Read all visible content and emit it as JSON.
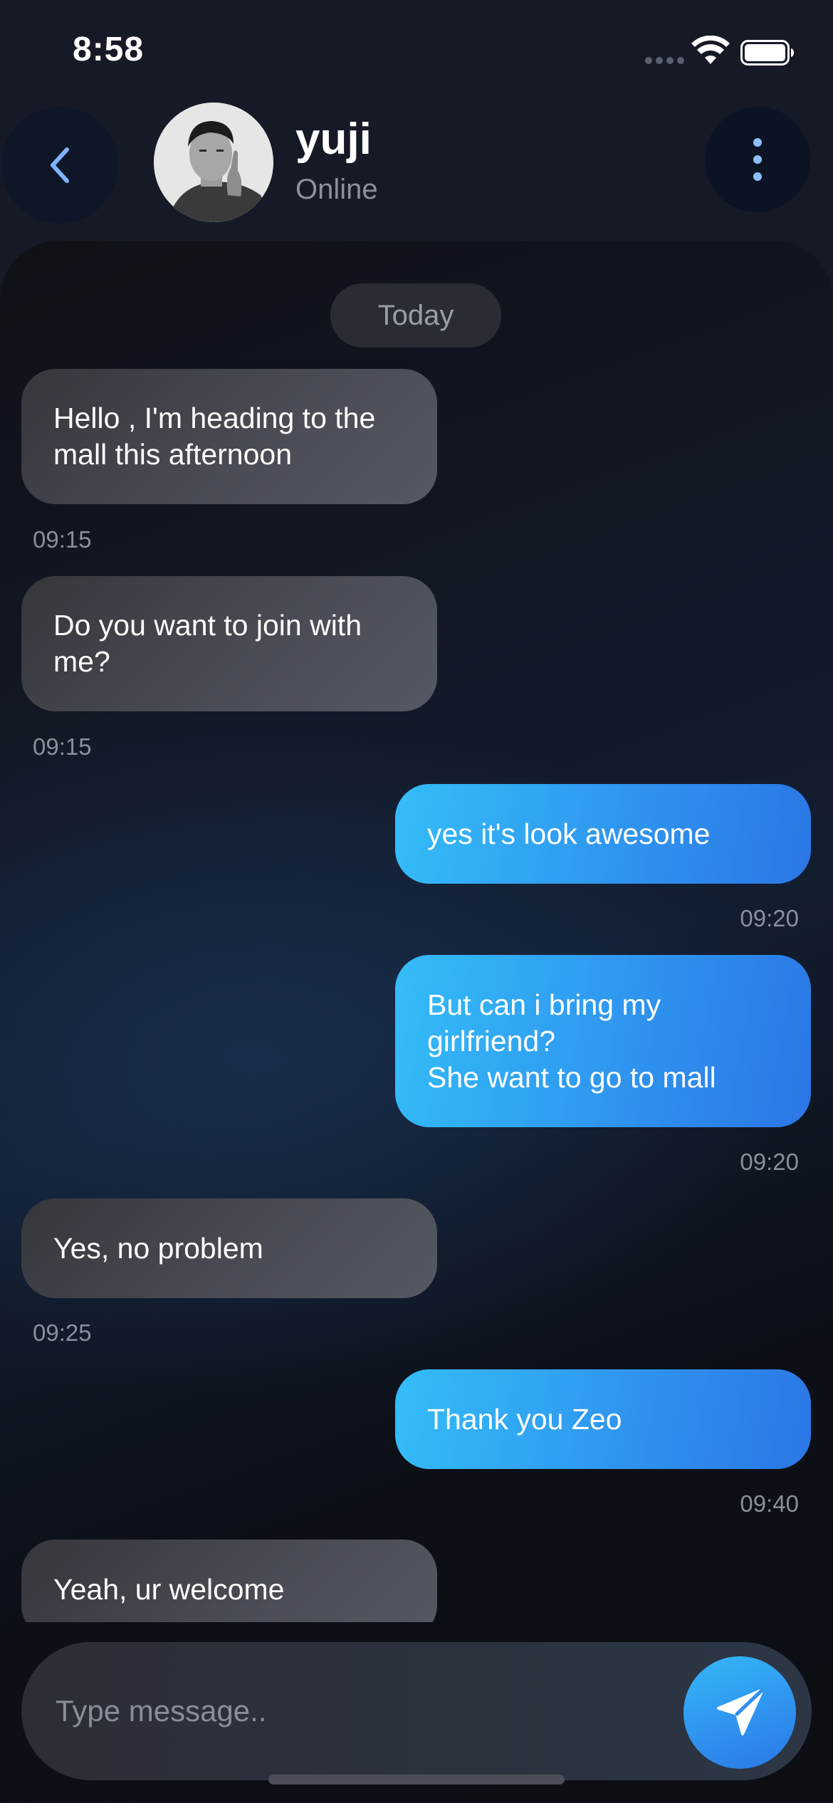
{
  "status_bar": {
    "time": "8:58",
    "icons": [
      "signal-dots-icon",
      "wifi-icon",
      "battery-icon"
    ]
  },
  "header": {
    "back_icon": "chevron-left-icon",
    "contact_name": "yuji",
    "contact_status": "Online",
    "more_icon": "vertical-dots-icon"
  },
  "chat": {
    "date_label": "Today",
    "messages": [
      {
        "direction": "in",
        "text": "Hello , I'm heading to the\nmall this afternoon",
        "time": "09:15"
      },
      {
        "direction": "in",
        "text": "Do you want to join with\nme?",
        "time": "09:15"
      },
      {
        "direction": "out",
        "text": "yes it's look awesome",
        "time": "09:20"
      },
      {
        "direction": "out",
        "text": "But can i bring my\ngirlfriend?\nShe want to go to mall",
        "time": "09:20"
      },
      {
        "direction": "in",
        "text": "Yes, no problem",
        "time": "09:25"
      },
      {
        "direction": "out",
        "text": "Thank you Zeo",
        "time": "09:40"
      },
      {
        "direction": "in",
        "text": "Yeah, ur welcome",
        "time": ""
      }
    ]
  },
  "composer": {
    "value": "",
    "placeholder": "Type message..",
    "send_icon": "send-icon"
  },
  "colors": {
    "background": "#161a26",
    "incoming_bubble": "#44464e",
    "outgoing_bubble_start": "#34bdf8",
    "outgoing_bubble_end": "#2b76e5",
    "muted_text": "#8a8f99",
    "accent": "#2f90ee"
  }
}
